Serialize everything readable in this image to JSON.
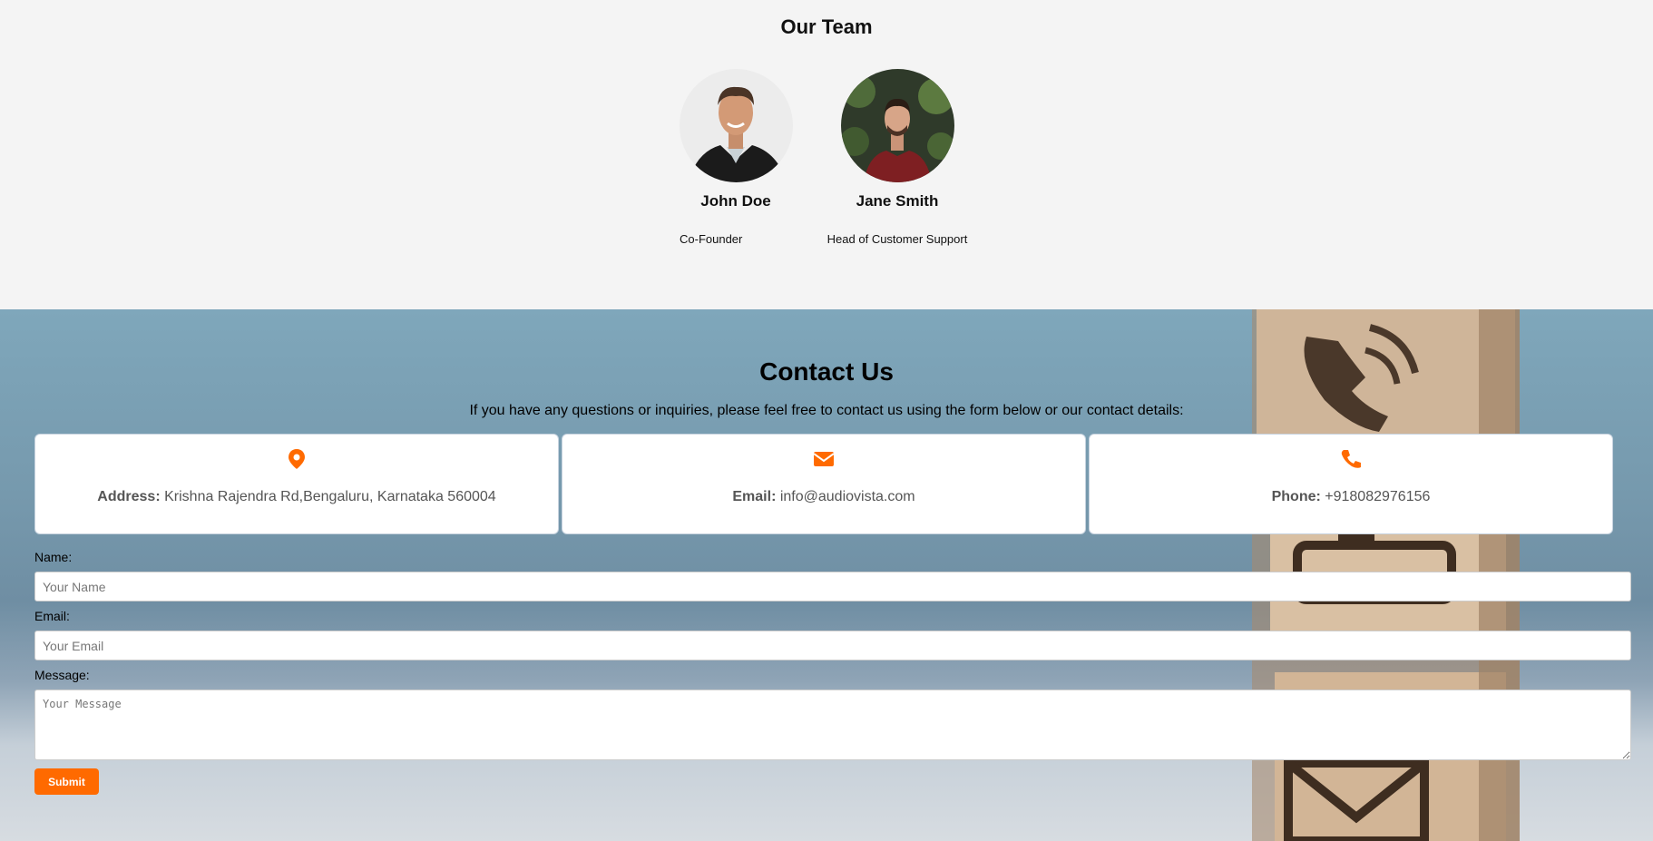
{
  "team": {
    "title": "Our Team",
    "members": [
      {
        "name": "John Doe",
        "role": "Co-Founder"
      },
      {
        "name": "Jane Smith",
        "role": "Head of Customer Support"
      }
    ]
  },
  "contact": {
    "title": "Contact Us",
    "intro": "If you have any questions or inquiries, please feel free to contact us using the form below or our contact details:",
    "cards": [
      {
        "icon": "map-marker-icon",
        "label": "Address:",
        "value": "Krishna Rajendra Rd,Bengaluru, Karnataka 560004"
      },
      {
        "icon": "envelope-icon",
        "label": "Email:",
        "value": "info@audiovista.com"
      },
      {
        "icon": "phone-icon",
        "label": "Phone:",
        "value": "+918082976156"
      }
    ],
    "accent_color": "#ff6a00"
  },
  "form": {
    "name_label": "Name:",
    "name_placeholder": "Your Name",
    "email_label": "Email:",
    "email_placeholder": "Your Email",
    "message_label": "Message:",
    "message_placeholder": "Your Message",
    "submit_label": "Submit"
  }
}
